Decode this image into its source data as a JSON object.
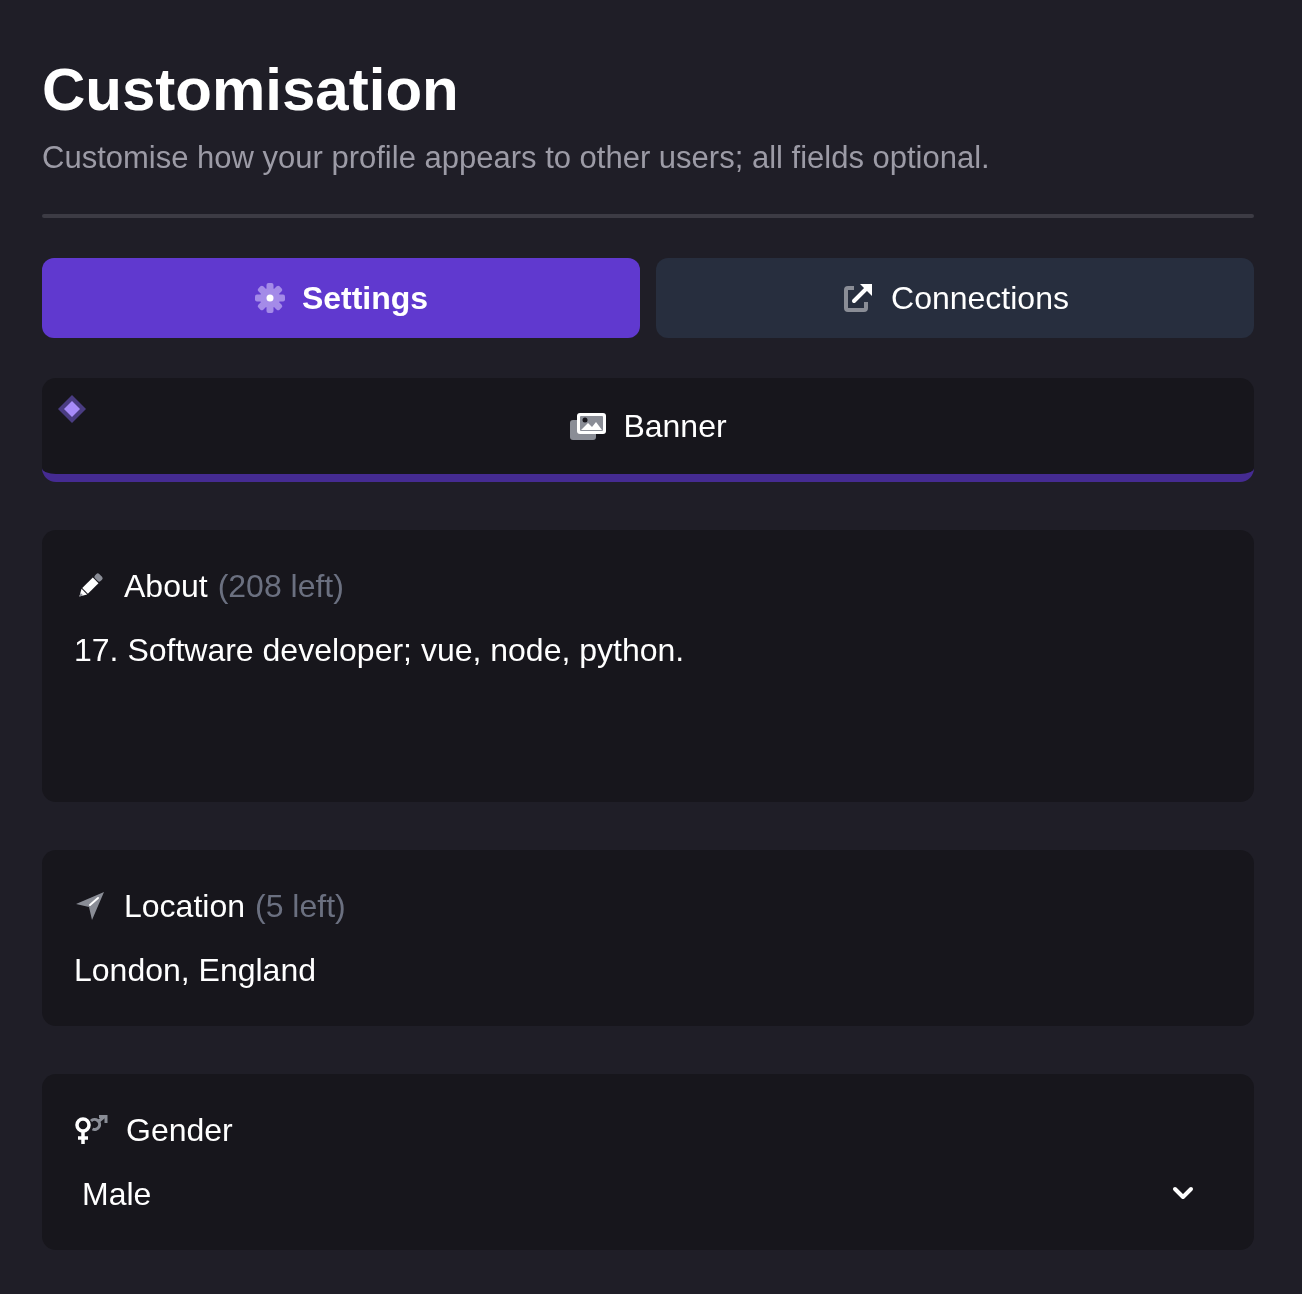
{
  "header": {
    "title": "Customisation",
    "subtitle": "Customise how your profile appears to other users; all fields optional."
  },
  "tabs": [
    {
      "label": "Settings",
      "selected": true
    },
    {
      "label": "Connections",
      "selected": false
    }
  ],
  "banner": {
    "label": "Banner"
  },
  "fields": [
    {
      "kind": "textarea",
      "label": "About",
      "remaining": "(208 left)",
      "value": "17. Software developer; vue, node, python."
    },
    {
      "kind": "text",
      "label": "Location",
      "remaining": "(5 left)",
      "value": "London, England"
    },
    {
      "kind": "select",
      "label": "Gender",
      "value": "Male"
    }
  ]
}
